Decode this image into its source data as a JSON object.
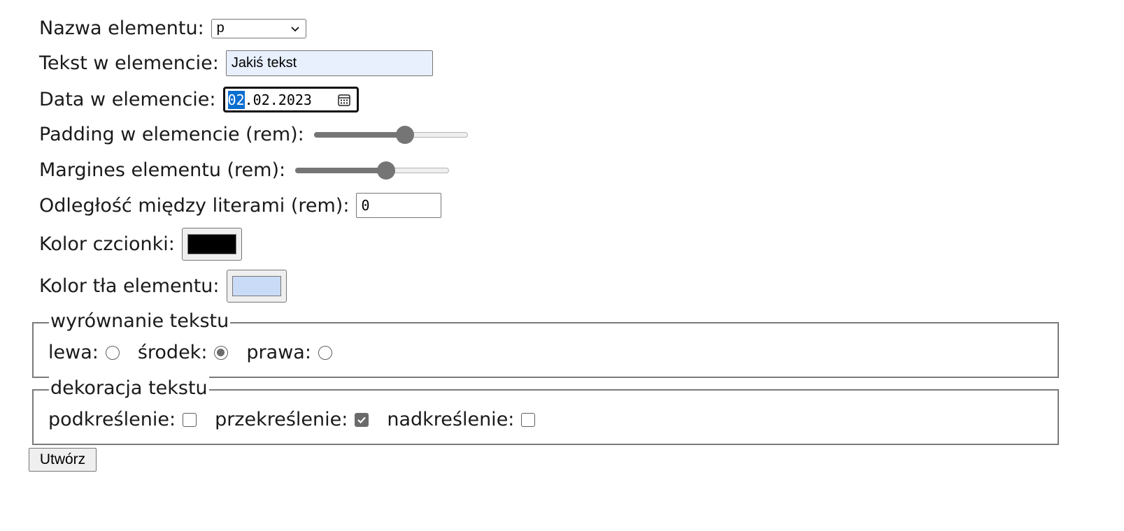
{
  "form": {
    "element_name": {
      "label": "Nazwa elementu:",
      "selected": "p"
    },
    "element_text": {
      "label": "Tekst w elemencie:",
      "value": "Jakiś tekst"
    },
    "element_date": {
      "label": "Data w elemencie:",
      "selected_segment": "02",
      "rest": ".02.2023"
    },
    "padding": {
      "label": "Padding w elemencie (rem):",
      "value_fraction": 0.59
    },
    "margin": {
      "label": "Margines elementu (rem):",
      "value_fraction": 0.59
    },
    "letter_spacing": {
      "label": "Odległość między literami (rem):",
      "value": "0"
    },
    "font_color": {
      "label": "Kolor czcionki:",
      "color": "#000000"
    },
    "bg_color": {
      "label": "Kolor tła elementu:",
      "color": "#c9dbf7"
    },
    "text_align": {
      "legend": "wyrównanie tekstu",
      "options": [
        {
          "label": "lewa:",
          "checked": false
        },
        {
          "label": "środek:",
          "checked": true
        },
        {
          "label": "prawa:",
          "checked": false
        }
      ]
    },
    "text_decoration": {
      "legend": "dekoracja tekstu",
      "options": [
        {
          "label": "podkreślenie:",
          "checked": false
        },
        {
          "label": "przekreślenie:",
          "checked": true
        },
        {
          "label": "nadkreślenie:",
          "checked": false
        }
      ]
    },
    "submit_label": "Utwórz"
  }
}
